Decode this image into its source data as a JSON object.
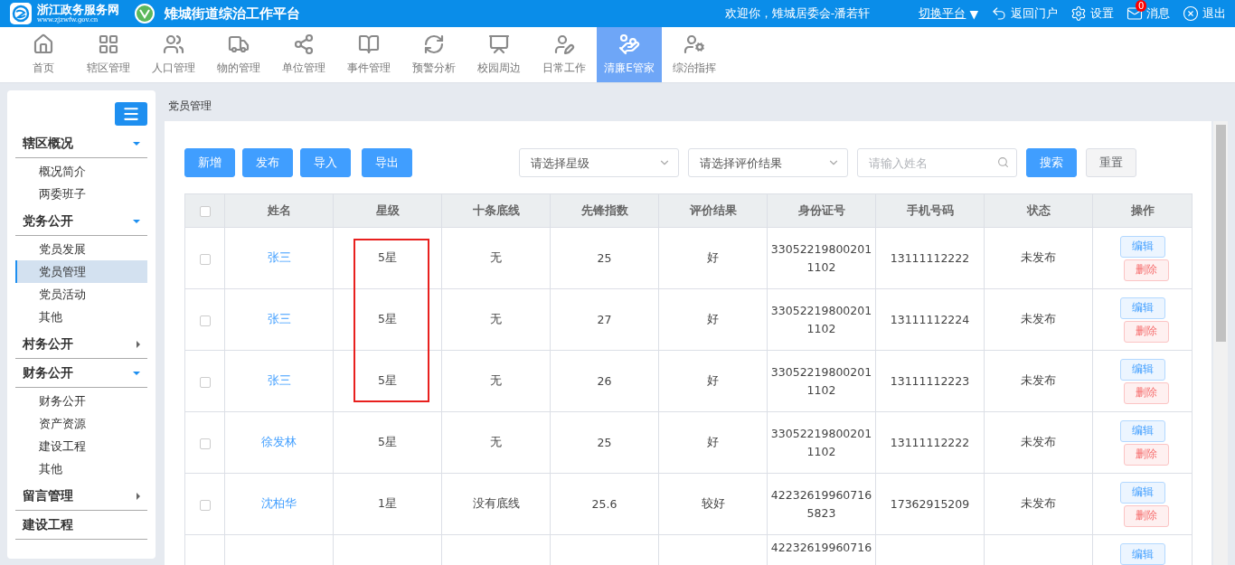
{
  "header": {
    "portal_name": "浙江政务服务网",
    "portal_url": "www.zjzwfw.gov.cn",
    "platform_title": "雉城街道综治工作平台",
    "welcome": "欢迎你，雉城居委会-潘若轩",
    "switch_platform": "切换平台",
    "switch_caret": "▼",
    "links": [
      {
        "kind": "back",
        "label": "返回门户"
      },
      {
        "kind": "settings",
        "label": "设置"
      },
      {
        "kind": "messages",
        "label": "消息",
        "badge": "0"
      },
      {
        "kind": "logout",
        "label": "退出"
      }
    ]
  },
  "nav": [
    {
      "kind": "home",
      "label": "首页",
      "selected": false
    },
    {
      "kind": "grid",
      "label": "辖区管理",
      "selected": false
    },
    {
      "kind": "people",
      "label": "人口管理",
      "selected": false
    },
    {
      "kind": "truck",
      "label": "物的管理",
      "selected": false
    },
    {
      "kind": "network",
      "label": "单位管理",
      "selected": false
    },
    {
      "kind": "book",
      "label": "事件管理",
      "selected": false
    },
    {
      "kind": "cycle",
      "label": "预警分析",
      "selected": false
    },
    {
      "kind": "board",
      "label": "校园周边",
      "selected": false
    },
    {
      "kind": "userpen",
      "label": "日常工作",
      "selected": false
    },
    {
      "kind": "coins",
      "label": "清廉E管家",
      "selected": true
    },
    {
      "kind": "officer",
      "label": "综治指挥",
      "selected": false
    }
  ],
  "sidebar": [
    {
      "kind": "group",
      "label": "辖区概况",
      "expanded": true,
      "children": [
        {
          "label": "概况简介",
          "selected": false
        },
        {
          "label": "两委班子",
          "selected": false
        }
      ]
    },
    {
      "kind": "group",
      "label": "党务公开",
      "expanded": true,
      "children": [
        {
          "label": "党员发展",
          "selected": false
        },
        {
          "label": "党员管理",
          "selected": true
        },
        {
          "label": "党员活动",
          "selected": false
        },
        {
          "label": "其他",
          "selected": false
        }
      ]
    },
    {
      "kind": "group",
      "label": "村务公开",
      "expanded": false
    },
    {
      "kind": "group",
      "label": "财务公开",
      "expanded": true,
      "children": [
        {
          "label": "财务公开",
          "selected": false
        },
        {
          "label": "资产资源",
          "selected": false
        },
        {
          "label": "建设工程",
          "selected": false
        },
        {
          "label": "其他",
          "selected": false
        }
      ]
    },
    {
      "kind": "group",
      "label": "留言管理",
      "expanded": false
    },
    {
      "kind": "link",
      "label": "建设工程"
    }
  ],
  "breadcrumb": "党员管理",
  "toolbar": {
    "buttons": [
      "新增",
      "发布",
      "导入",
      "导出"
    ],
    "filters": [
      {
        "kind": "select",
        "placeholder": "请选择星级"
      },
      {
        "kind": "select",
        "placeholder": "请选择评价结果"
      },
      {
        "kind": "search",
        "placeholder": "请输入姓名"
      }
    ],
    "search_button": "搜索",
    "reset_button": "重置"
  },
  "table": {
    "header_checked": false,
    "columns": [
      "姓名",
      "星级",
      "十条底线",
      "先锋指数",
      "评价结果",
      "身份证号",
      "手机号码",
      "状态",
      "操作"
    ],
    "rows": [
      {
        "checked": false,
        "highlighted": true,
        "name": "张三",
        "stars": "5星",
        "bottom_line": "无",
        "index": "25",
        "result": "好",
        "id": "330522198002011102",
        "phone": "13111112222",
        "status": "未发布",
        "actions": [
          "编辑",
          "删除"
        ]
      },
      {
        "checked": false,
        "highlighted": true,
        "name": "张三",
        "stars": "5星",
        "bottom_line": "无",
        "index": "27",
        "result": "好",
        "id": "330522198002011102",
        "phone": "13111112224",
        "status": "未发布",
        "actions": [
          "编辑",
          "删除"
        ]
      },
      {
        "checked": false,
        "highlighted": true,
        "name": "张三",
        "stars": "5星",
        "bottom_line": "无",
        "index": "26",
        "result": "好",
        "id": "330522198002011102",
        "phone": "13111112223",
        "status": "未发布",
        "actions": [
          "编辑",
          "删除"
        ]
      },
      {
        "checked": false,
        "name": "徐发林",
        "stars": "5星",
        "bottom_line": "无",
        "index": "25",
        "result": "好",
        "id": "330522198002011102",
        "phone": "13111112222",
        "status": "未发布",
        "actions": [
          "编辑",
          "删除"
        ]
      },
      {
        "checked": false,
        "name": "沈柏华",
        "stars": "1星",
        "bottom_line": "没有底线",
        "index": "25.6",
        "result": "较好",
        "id": "422326199607165823",
        "phone": "17362915209",
        "status": "未发布",
        "actions": [
          "编辑",
          "删除"
        ]
      },
      {
        "id": "42232619960716",
        "actions": [
          "编辑"
        ]
      }
    ]
  }
}
